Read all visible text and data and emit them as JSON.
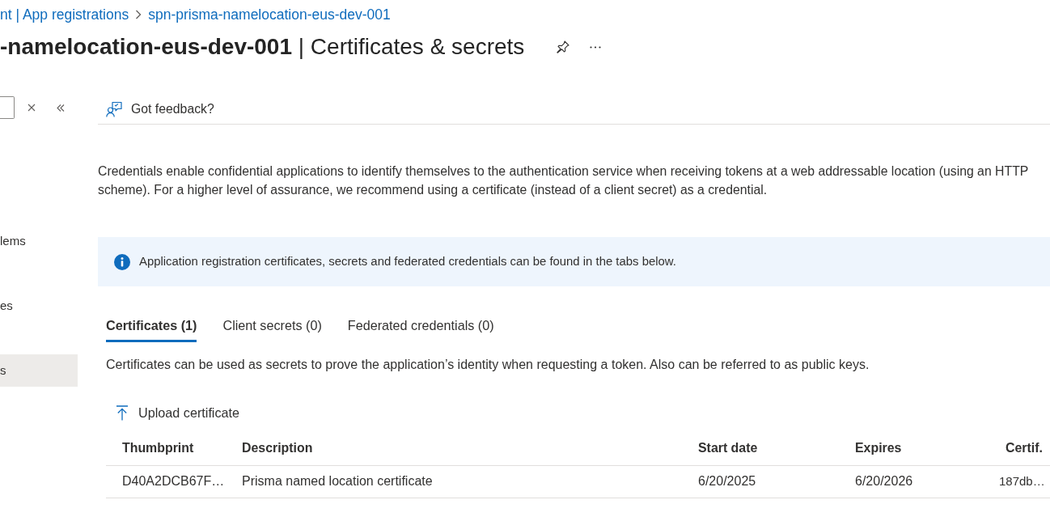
{
  "breadcrumb": [
    {
      "label": "nt | App registrations"
    },
    {
      "label": "spn-prisma-namelocation-eus-dev-001"
    }
  ],
  "title": "**-namelocation-eus-dev-001** | Certificates & secrets",
  "sidebar": {
    "items": [
      {
        "label": "lems",
        "selected": false
      },
      {
        "label": "es",
        "selected": false
      },
      {
        "label": "s",
        "selected": true
      }
    ]
  },
  "toolbar": {
    "feedback": "Got feedback?"
  },
  "description": "Credentials enable confidential applications to identify themselves to the authentication service when receiving tokens at a web addressable location (using an HTTP\nscheme). For a higher level of assurance, we recommend using a certificate (instead of a client secret) as a credential.",
  "info_bar": {
    "text": "Application registration certificates, secrets and federated credentials can be found in the tabs below."
  },
  "tabs": [
    {
      "label": "Certificates (1)",
      "selected": true
    },
    {
      "label": "Client secrets (0)",
      "selected": false
    },
    {
      "label": "Federated credentials (0)",
      "selected": false
    }
  ],
  "tab_description": "Certificates can be used as secrets to prove the application’s identity when requesting a token. Also can be referred to as public keys.",
  "upload_button": "Upload certificate",
  "table": {
    "columns": [
      "Thumbprint",
      "Description",
      "Start date",
      "Expires",
      "Certif."
    ],
    "rows": [
      [
        "D40A2DCB67F…",
        "Prisma named location certificate",
        "6/20/2025",
        "6/20/2026",
        "187db…"
      ]
    ]
  }
}
